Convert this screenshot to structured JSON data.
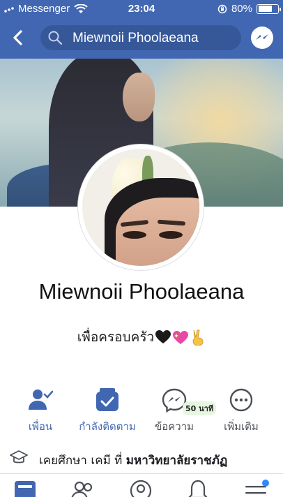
{
  "status_bar": {
    "carrier": "Messenger",
    "time": "23:04",
    "battery": "80%",
    "battery_level": 0.8
  },
  "nav": {
    "search_value": "Miewnoii Phoolaeana"
  },
  "profile": {
    "name": "Miewnoii Phoolaeana",
    "bio": "เพื่อครอบครัว"
  },
  "actions": [
    {
      "label": "เพื่อน",
      "icon": "friend-check-icon"
    },
    {
      "label": "กำลังติดตาม",
      "icon": "following-inbox-icon"
    },
    {
      "label": "ข้อความ",
      "icon": "messenger-icon",
      "badge": "50 นาที"
    },
    {
      "label": "เพิ่มเติม",
      "icon": "more-icon"
    }
  ],
  "info": {
    "prefix": "เคยศึกษา เคมี ที่",
    "school": "มหาวิทยาลัยราชภัฏ",
    "icon": "graduation-cap-icon"
  },
  "tabbar": {
    "icons": [
      "news-feed-icon",
      "friends-icon",
      "profile-icon",
      "notifications-icon",
      "menu-icon"
    ]
  },
  "colors": {
    "brand": "#4267b2",
    "search_bg": "#365899",
    "action_blue": "#4267b2",
    "badge_bg": "#e6f6df",
    "notification_dot": "#2e89ff"
  }
}
